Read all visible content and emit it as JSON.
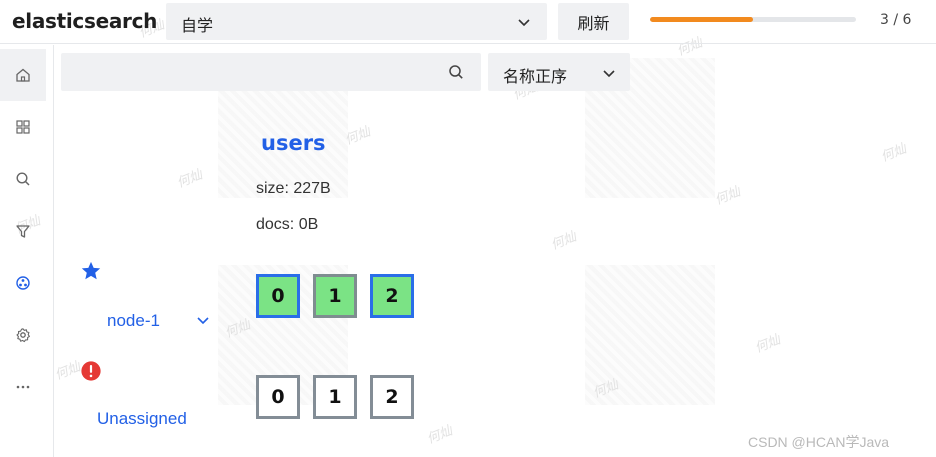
{
  "app": {
    "title": "elasticsearch"
  },
  "topbar": {
    "cluster_select_value": "自学",
    "refresh_label": "刷新",
    "progress_fraction": 0.5,
    "page_count": "3 / 6"
  },
  "sidebar": {
    "items": [
      {
        "icon": "home-icon"
      },
      {
        "icon": "grid-icon"
      },
      {
        "icon": "search-icon"
      },
      {
        "icon": "filter-icon"
      },
      {
        "icon": "cluster-icon"
      },
      {
        "icon": "gear-icon"
      },
      {
        "icon": "more-icon"
      }
    ]
  },
  "filters": {
    "search_placeholder": "",
    "sort_value": "名称正序"
  },
  "index": {
    "name": "users",
    "size": "size: 227B",
    "docs": "docs: 0B"
  },
  "nodes": [
    {
      "name": "node-1",
      "shards": [
        "0",
        "1",
        "2"
      ]
    }
  ],
  "unassigned": {
    "label": "Unassigned",
    "shards": [
      "0",
      "1",
      "2"
    ]
  },
  "colors": {
    "accent": "#2260e6",
    "shard_green": "#7be385",
    "progress": "#f28a1e",
    "warning": "#e53935"
  },
  "watermarks": [
    "何灿",
    "何灿",
    "何灿",
    "何灿",
    "何灿",
    "何灿",
    "何灿",
    "何灿",
    "何灿",
    "何灿",
    "何灿",
    "何灿",
    "何灿",
    "何灿"
  ],
  "footer": {
    "credit": "CSDN @HCAN学Java"
  }
}
